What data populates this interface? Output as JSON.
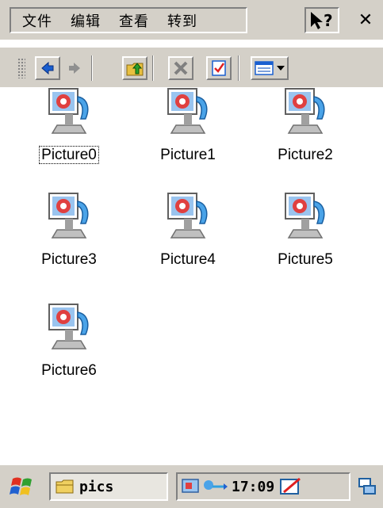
{
  "menu": {
    "items": [
      "文件",
      "编辑",
      "查看",
      "转到"
    ],
    "help_label": "?",
    "close_label": "✕"
  },
  "toolbar": {
    "buttons": [
      "back-icon",
      "forward-icon",
      "up-folder-icon",
      "delete-icon",
      "properties-icon",
      "view-icon"
    ]
  },
  "files": [
    {
      "name": "Picture0",
      "focused": true
    },
    {
      "name": "Picture1"
    },
    {
      "name": "Picture2"
    },
    {
      "name": "Picture3"
    },
    {
      "name": "Picture4"
    },
    {
      "name": "Picture5"
    },
    {
      "name": "Picture6"
    }
  ],
  "taskbar": {
    "task_label": "pics",
    "clock": "17:09"
  },
  "colors": {
    "chrome": "#d4d0c8",
    "accent_blue": "#1a5fd0",
    "icon_red": "#e04040"
  }
}
